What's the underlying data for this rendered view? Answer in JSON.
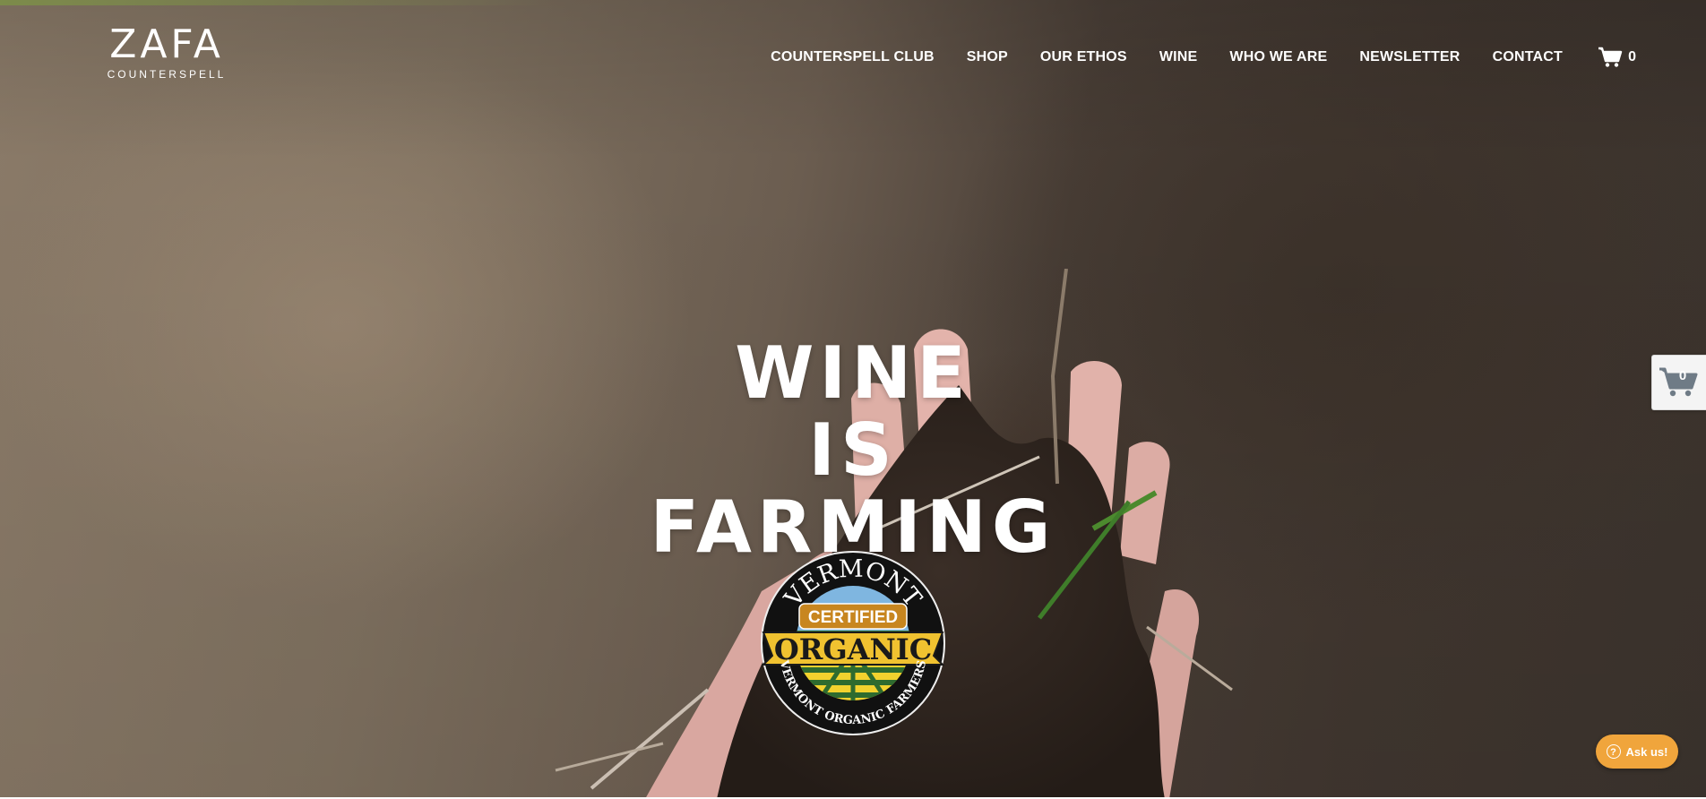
{
  "brand": {
    "name": "ZAFA",
    "subtitle": "COUNTERSPELL"
  },
  "nav": {
    "items": [
      {
        "label": "COUNTERSPELL CLUB"
      },
      {
        "label": "SHOP"
      },
      {
        "label": "OUR ETHOS"
      },
      {
        "label": "WINE"
      },
      {
        "label": "WHO WE ARE"
      },
      {
        "label": "NEWSLETTER"
      },
      {
        "label": "CONTACT"
      }
    ]
  },
  "cart": {
    "icon": "cart-icon",
    "count": "0"
  },
  "hero": {
    "headline_lines": [
      "WINE",
      "IS",
      "FARMING"
    ],
    "background": "soil-in-hand-photo"
  },
  "badge": {
    "top_text": "VERMONT",
    "middle_text": "CERTIFIED",
    "main_text": "ORGANIC",
    "bottom_text": "VERMONT ORGANIC FARMERS"
  },
  "side_cart": {
    "icon": "cart-icon",
    "count": "0"
  },
  "chat": {
    "icon": "question-icon",
    "label": "Ask us!"
  },
  "colors": {
    "accent": "#f0a53c",
    "text": "#ffffff"
  }
}
